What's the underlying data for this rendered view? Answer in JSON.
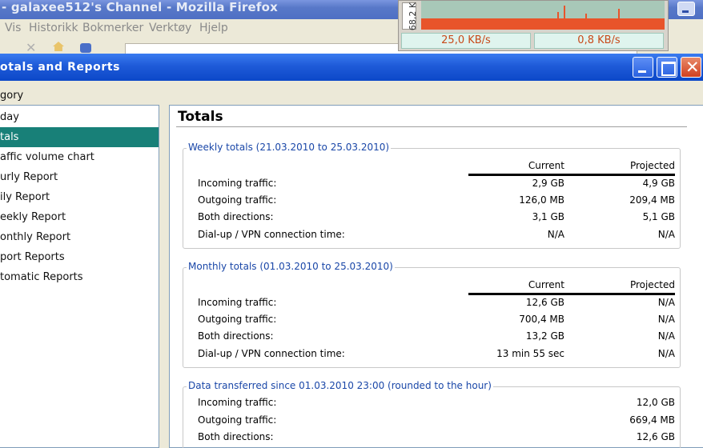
{
  "browser": {
    "title": "- galaxee512's Channel - Mozilla Firefox",
    "menus": [
      "Vis",
      "Historikk",
      "Bokmerker",
      "Verktøy",
      "Hjelp"
    ]
  },
  "meter": {
    "axis_label": "68,2 K",
    "down_rate": "25,0 KB/s",
    "up_rate": "0,8 KB/s",
    "colors": {
      "graph_bg": "#a8c8b8",
      "traffic": "#e8542a"
    }
  },
  "dialog": {
    "title": "otals and Reports",
    "category_label": "gory"
  },
  "sidebar": {
    "items": [
      {
        "label": "day",
        "selected": false
      },
      {
        "label": "tals",
        "selected": true
      },
      {
        "label": "affic volume chart",
        "selected": false
      },
      {
        "label": "urly Report",
        "selected": false
      },
      {
        "label": "ily Report",
        "selected": false
      },
      {
        "label": "eekly Report",
        "selected": false
      },
      {
        "label": "onthly Report",
        "selected": false
      },
      {
        "label": "port Reports",
        "selected": false
      },
      {
        "label": "tomatic Reports",
        "selected": false
      }
    ],
    "selected_color": "#188078"
  },
  "content": {
    "title": "Totals",
    "weekly": {
      "legend": "Weekly totals (21.03.2010 to 25.03.2010)",
      "col_current": "Current",
      "col_projected": "Projected",
      "rows": [
        {
          "label": "Incoming traffic:",
          "current": "2,9 GB",
          "projected": "4,9 GB"
        },
        {
          "label": "Outgoing traffic:",
          "current": "126,0 MB",
          "projected": "209,4 MB"
        },
        {
          "label": "Both directions:",
          "current": "3,1 GB",
          "projected": "5,1 GB"
        },
        {
          "label": "Dial-up / VPN connection time:",
          "current": "N/A",
          "projected": "N/A"
        }
      ]
    },
    "monthly": {
      "legend": "Monthly totals (01.03.2010 to 25.03.2010)",
      "col_current": "Current",
      "col_projected": "Projected",
      "rows": [
        {
          "label": "Incoming traffic:",
          "current": "12,6 GB",
          "projected": "N/A"
        },
        {
          "label": "Outgoing traffic:",
          "current": "700,4 MB",
          "projected": "N/A"
        },
        {
          "label": "Both directions:",
          "current": "13,2 GB",
          "projected": "N/A"
        },
        {
          "label": "Dial-up / VPN connection time:",
          "current": "13 min 55 sec",
          "projected": "N/A"
        }
      ]
    },
    "since": {
      "legend": "Data transferred since 01.03.2010 23:00 (rounded to the hour)",
      "rows": [
        {
          "label": "Incoming traffic:",
          "value": "12,0 GB"
        },
        {
          "label": "Outgoing traffic:",
          "value": "669,4 MB"
        },
        {
          "label": "Both directions:",
          "value": "12,6 GB"
        }
      ]
    }
  }
}
